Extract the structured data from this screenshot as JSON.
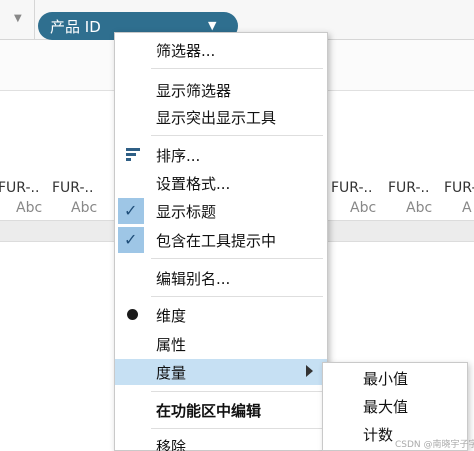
{
  "field_pill": {
    "label": "产品 ID"
  },
  "columns": [
    {
      "header": "FUR-..",
      "sub": "Abc"
    },
    {
      "header": "FUR-..",
      "sub": "Abc"
    },
    {
      "header": "FUR-..",
      "sub": "Abc"
    },
    {
      "header": "FUR-..",
      "sub": "Abc"
    },
    {
      "header": "FUR-",
      "sub": "A"
    }
  ],
  "left_column": {
    "header": "FUR-..",
    "sub": "Abc"
  },
  "menu": {
    "items": [
      {
        "label": "筛选器..."
      },
      {
        "label": "显示筛选器"
      },
      {
        "label": "显示突出显示工具"
      },
      {
        "label": "排序...",
        "icon": "sort-icon"
      },
      {
        "label": "设置格式..."
      },
      {
        "label": "显示标题",
        "checked": true
      },
      {
        "label": "包含在工具提示中",
        "checked": true
      },
      {
        "label": "编辑别名..."
      },
      {
        "label": "维度",
        "selected": true
      },
      {
        "label": "属性"
      },
      {
        "label": "度量",
        "submenu": true,
        "highlighted": true
      },
      {
        "label": "在功能区中编辑",
        "bold": true
      },
      {
        "label": "移除"
      }
    ]
  },
  "submenu": {
    "items": [
      {
        "label": "最小值"
      },
      {
        "label": "最大值"
      },
      {
        "label": "计数"
      }
    ]
  },
  "watermark": "CSDN @南晓宇子字",
  "colors": {
    "pill": "#2f6f8f",
    "highlight": "#c6e0f3",
    "check_cell": "#9ec6e6"
  }
}
